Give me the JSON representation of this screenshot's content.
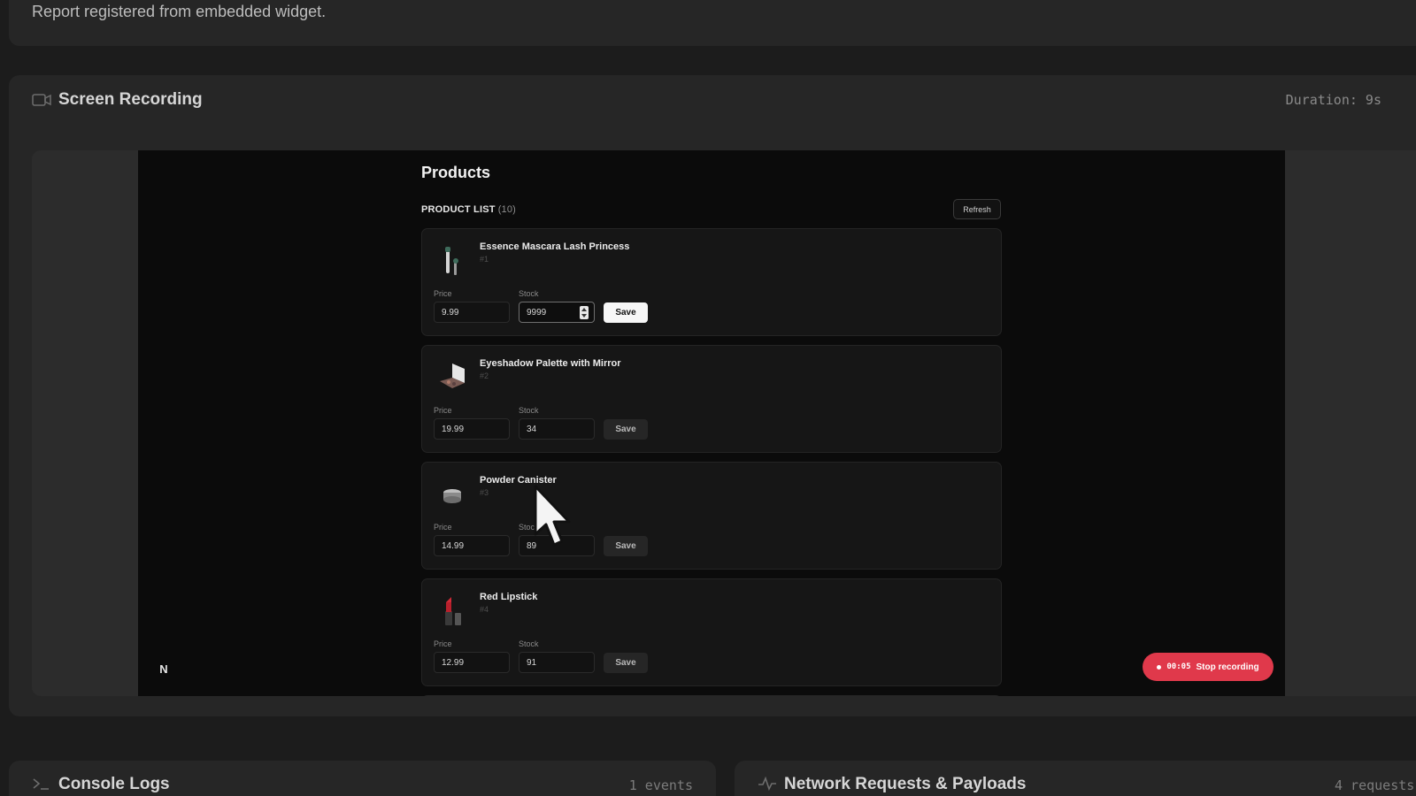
{
  "top": {
    "message": "Report registered from embedded widget."
  },
  "recording": {
    "title": "Screen Recording",
    "icon": "video-camera-icon",
    "duration": "Duration: 9s"
  },
  "app": {
    "title": "Products",
    "list_label": "PRODUCT LIST",
    "list_count": "(10)",
    "refresh_label": "Refresh",
    "price_label": "Price",
    "stock_label": "Stock",
    "save_label": "Save",
    "products": [
      {
        "name": "Essence Mascara Lash Princess",
        "id": "#1",
        "price": "9.99",
        "stock": "9999",
        "thumb": "mascara-icon"
      },
      {
        "name": "Eyeshadow Palette with Mirror",
        "id": "#2",
        "price": "19.99",
        "stock": "34",
        "thumb": "palette-icon"
      },
      {
        "name": "Powder Canister",
        "id": "#3",
        "price": "14.99",
        "stock": "89",
        "thumb": "powder-icon"
      },
      {
        "name": "Red Lipstick",
        "id": "#4",
        "price": "12.99",
        "stock": "91",
        "thumb": "lipstick-icon"
      }
    ],
    "stop_timer": "00:05",
    "stop_label": "Stop recording",
    "badge": "N"
  },
  "console": {
    "title": "Console Logs",
    "count": "1 events",
    "icon": "terminal-icon"
  },
  "network": {
    "title": "Network Requests & Payloads",
    "count": "4 requests",
    "icon": "activity-icon"
  },
  "colors": {
    "stop_button": "#e0394b",
    "background": "#1c1c1c",
    "panel": "#262626"
  }
}
